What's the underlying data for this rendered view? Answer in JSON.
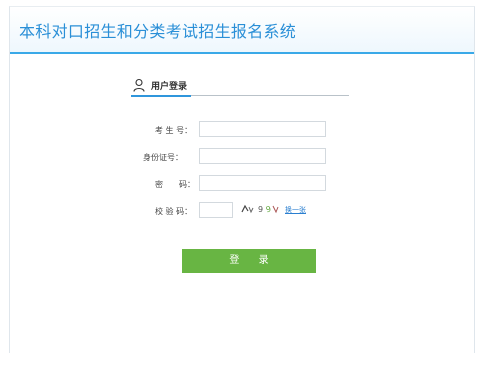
{
  "header": {
    "title": "本科对口招生和分类考试招生报名系统"
  },
  "login": {
    "title": "用户登录",
    "fields": [
      {
        "label": "考 生 号：",
        "value": ""
      },
      {
        "label": "身份证号：",
        "value": ""
      },
      {
        "label": "密　　码：",
        "value": ""
      },
      {
        "label": "校 验 码：",
        "value": ""
      }
    ],
    "captcha_text": "2\"9 9",
    "refresh_label": "换一张",
    "submit_label": "登 录"
  },
  "colors": {
    "accent": "#2a8fd7",
    "header_line": "#3aa9e8",
    "button": "#68b543"
  }
}
